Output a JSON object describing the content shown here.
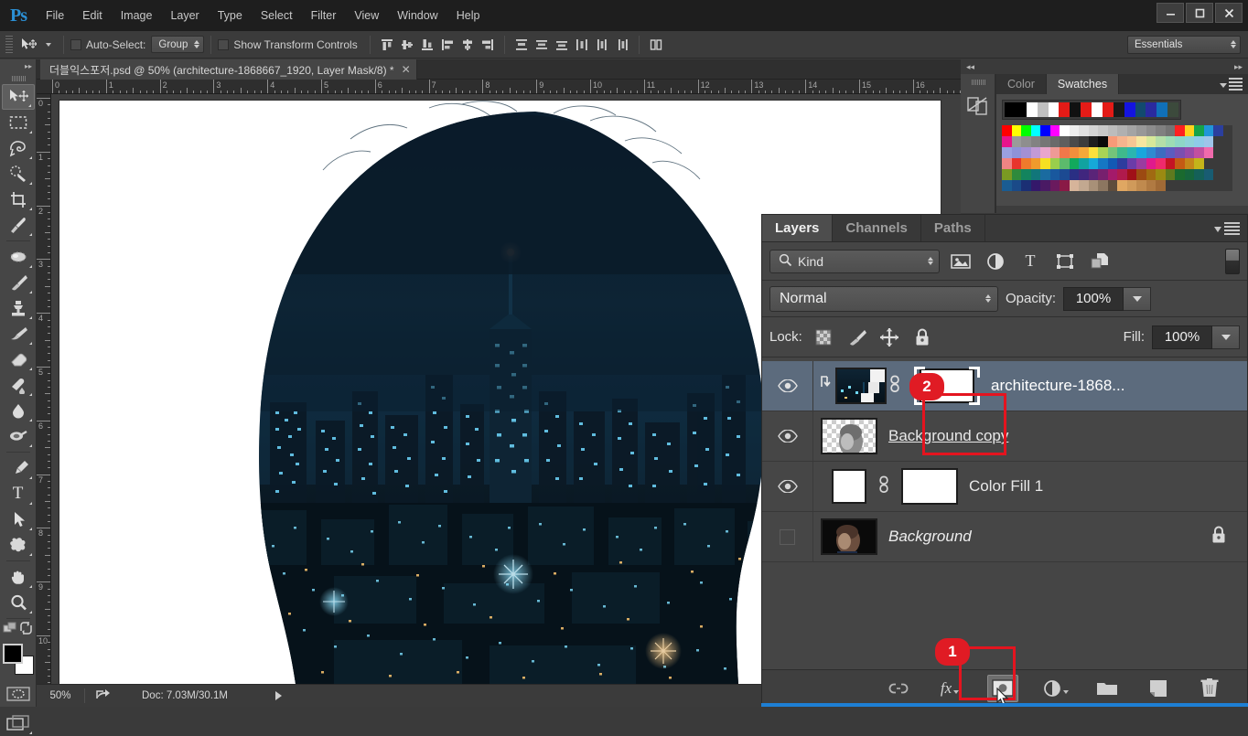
{
  "app": {
    "name": "Ps",
    "logo_color": "#2b8fd4"
  },
  "window_controls": {
    "minimize": "—",
    "maximize": "❐",
    "close": "✕"
  },
  "menubar": {
    "items": [
      "File",
      "Edit",
      "Image",
      "Layer",
      "Type",
      "Select",
      "Filter",
      "View",
      "Window",
      "Help"
    ]
  },
  "options_bar": {
    "tool_icon": "move-tool-icon",
    "auto_select_label": "Auto-Select:",
    "auto_select_checked": false,
    "auto_select_value": "Group",
    "show_transform_label": "Show Transform Controls",
    "show_transform_checked": false,
    "align_icons": [
      "align-top-edges",
      "align-vertical-centers",
      "align-bottom-edges",
      "align-left-edges",
      "align-horizontal-centers",
      "align-right-edges"
    ],
    "distribute_icons": [
      "distribute-top-edges",
      "distribute-vertical-centers",
      "distribute-bottom-edges",
      "distribute-left-edges",
      "distribute-horizontal-centers",
      "distribute-right-edges"
    ],
    "auto_align_icon": "auto-align-layers-icon",
    "workspace": "Essentials"
  },
  "toolbar": {
    "tools": [
      {
        "name": "move-tool",
        "glyph": "move",
        "active": true
      },
      {
        "name": "rectangular-marquee-tool",
        "glyph": "marquee"
      },
      {
        "name": "lasso-tool",
        "glyph": "lasso"
      },
      {
        "name": "quick-selection-tool",
        "glyph": "quickselect"
      },
      {
        "name": "crop-tool",
        "glyph": "crop"
      },
      {
        "name": "eyedropper-tool",
        "glyph": "eyedropper"
      },
      {
        "name": "spot-healing-brush-tool",
        "glyph": "heal"
      },
      {
        "name": "brush-tool",
        "glyph": "brush"
      },
      {
        "name": "clone-stamp-tool",
        "glyph": "stamp"
      },
      {
        "name": "history-brush-tool",
        "glyph": "historybrush"
      },
      {
        "name": "eraser-tool",
        "glyph": "eraser"
      },
      {
        "name": "gradient-tool",
        "glyph": "paintbucket"
      },
      {
        "name": "blur-tool",
        "glyph": "blur"
      },
      {
        "name": "dodge-tool",
        "glyph": "dodge"
      },
      {
        "name": "pen-tool",
        "glyph": "pen"
      },
      {
        "name": "horizontal-type-tool",
        "glyph": "type"
      },
      {
        "name": "path-selection-tool",
        "glyph": "pathselect"
      },
      {
        "name": "custom-shape-tool",
        "glyph": "shape"
      },
      {
        "name": "hand-tool",
        "glyph": "hand"
      },
      {
        "name": "zoom-tool",
        "glyph": "zoom"
      }
    ],
    "foreground_color": "#000000",
    "background_color": "#ffffff",
    "quick_mask_icon": "quick-mask-icon",
    "screen_mode_icon": "screen-mode-icon",
    "edit_toolbar_icon": "edit-toolbar-icon"
  },
  "document": {
    "tab_title": "더블익스포저.psd @ 50% (architecture-1868667_1920, Layer Mask/8) *",
    "close_glyph": "✕",
    "ruler_h_labels": [
      "0",
      "1",
      "2",
      "3",
      "4",
      "5",
      "6",
      "7",
      "8",
      "9",
      "10",
      "11",
      "12",
      "13",
      "14",
      "15",
      "16"
    ],
    "ruler_v_labels": [
      "0",
      "1",
      "2",
      "3",
      "4",
      "5",
      "6",
      "7",
      "8",
      "9",
      "10"
    ]
  },
  "status_bar": {
    "zoom": "50%",
    "share_icon": "share-icon",
    "doc_info": "Doc: 7.03M/30.1M",
    "arrow_icon": "play-arrow-icon"
  },
  "color_dock": {
    "collapse_left_icon": "collapse-left-icon",
    "expand_right_icon": "expand-right-icon",
    "icon_buttons": [
      "adjustments-icon"
    ],
    "tabs": [
      {
        "label": "Color",
        "active": false
      },
      {
        "label": "Swatches",
        "active": true
      }
    ],
    "menu_icon": "panel-menu-icon",
    "recent_swatches": [
      "#000000",
      "#000000",
      "#ffffff",
      "#c0c0c0",
      "#ffffff",
      "#e41b17",
      "#111111",
      "#e41b17",
      "#ffffff",
      "#e41b17",
      "#1a1a1a",
      "#1414e0",
      "#124a6e",
      "#2a2a9e",
      "#1070b8",
      "#3c4a3c"
    ],
    "swatch_rows": [
      [
        "#ff0000",
        "#ffff00",
        "#00ff00",
        "#00ffff",
        "#0000ff",
        "#ff00ff",
        "#ffffff",
        "#ededed",
        "#e0e0e0",
        "#d4d4d4",
        "#c8c8c8",
        "#bcbcbc",
        "#b0b0b0",
        "#a4a4a4",
        "#989898",
        "#8c8c8c",
        "#808080",
        "#747474",
        "#ff2020",
        "#ffd21e",
        "#16a349",
        "#2196d8",
        "#2b3f9e",
        "#3a3a3a"
      ],
      [
        "#e8148c",
        "#9a9a9a",
        "#8e8e8e",
        "#828282",
        "#767676",
        "#6a6a6a",
        "#5e5e5e",
        "#4a4a4a",
        "#3c3c3c",
        "#1e1e1e",
        "#0a0a0a",
        "#f79a78",
        "#f5b48e",
        "#f7c694",
        "#f5e6a0",
        "#d6e89a",
        "#b4dfa8",
        "#9ddcb4",
        "#8ed6c6",
        "#8fd2d8",
        "#8ecbe8",
        "#9ec5ea",
        "#3a3a3a",
        "#3a3a3a"
      ],
      [
        "#9aa0e0",
        "#8e92d8",
        "#a390d4",
        "#c29ad6",
        "#e9a6cc",
        "#ef9a96",
        "#f0784a",
        "#f28f3c",
        "#f5a83a",
        "#fbe03c",
        "#a8d455",
        "#74c47a",
        "#3fb98c",
        "#2bb5b0",
        "#19a6dc",
        "#2e8ad0",
        "#3c6cc0",
        "#5c5cc0",
        "#7a4fb0",
        "#9a4aa8",
        "#c24fa0",
        "#f06aac",
        "#3a3a3a",
        "#3a3a3a"
      ],
      [
        "#f08484",
        "#e8342c",
        "#ef7a2c",
        "#ef9a2c",
        "#f5e021",
        "#9ace4c",
        "#5cba6c",
        "#12a95c",
        "#11a2a0",
        "#16a8d8",
        "#1577c4",
        "#1259b4",
        "#2d3c9e",
        "#6b3ca8",
        "#9a3ca0",
        "#e01a8c",
        "#ef2a6c",
        "#c41424",
        "#c45a14",
        "#c4861a",
        "#c4b41a",
        "#3a3a3a",
        "#3a3a3a",
        "#3a3a3a"
      ],
      [
        "#7a9a22",
        "#2f8a3c",
        "#13845e",
        "#11767a",
        "#1a6ba0",
        "#19589e",
        "#1c4a92",
        "#2a2f84",
        "#40267e",
        "#5a2478",
        "#77206e",
        "#a41a6a",
        "#b01a4c",
        "#a01018",
        "#9c4a12",
        "#a06a12",
        "#9a8a12",
        "#5e7a1e",
        "#1a6a2e",
        "#16653c",
        "#146058",
        "#185c72",
        "#3a3a3a",
        "#3a3a3a"
      ],
      [
        "#1a5c92",
        "#1a4a88",
        "#1b2f74",
        "#34186a",
        "#4a1a64",
        "#6a1a5e",
        "#8a1a46",
        "#d6b49a",
        "#c2a890",
        "#a89078",
        "#8c7660",
        "#5e4c3c",
        "#e0a762",
        "#d09a5a",
        "#c08a4e",
        "#b07a42",
        "#a06a36",
        "#3a3a3a",
        "#3a3a3a",
        "#3a3a3a",
        "#3a3a3a",
        "#3a3a3a",
        "#3a3a3a",
        "#3a3a3a"
      ]
    ]
  },
  "layers_panel": {
    "tabs": [
      {
        "label": "Layers",
        "active": true
      },
      {
        "label": "Channels",
        "active": false
      },
      {
        "label": "Paths",
        "active": false
      }
    ],
    "menu_icon": "panel-menu-icon",
    "filter": {
      "kind_label": "Kind",
      "search_icon": "search-icon",
      "type_filters": [
        "filter-pixel-layers-icon",
        "filter-adjustment-layers-icon",
        "filter-type-layers-icon",
        "filter-shape-layers-icon",
        "filter-smart-objects-icon"
      ],
      "toggle_icon": "filter-toggle-icon"
    },
    "blend_mode": "Normal",
    "opacity_label": "Opacity:",
    "opacity_value": "100%",
    "lock_label": "Lock:",
    "lock_icons": [
      "lock-transparent-pixels-icon",
      "lock-image-pixels-icon",
      "lock-position-icon",
      "lock-all-icon"
    ],
    "fill_label": "Fill:",
    "fill_value": "100%",
    "rows": [
      {
        "name": "architecture-1868...",
        "visible": true,
        "selected": true,
        "clipped": true,
        "thumb": "city-thumbnail",
        "linked": true,
        "mask": "white-mask-selected",
        "locked": false,
        "style": "normal"
      },
      {
        "name": "Background copy",
        "visible": true,
        "selected": false,
        "clipped": false,
        "thumb": "head-transparent-thumbnail",
        "linked": false,
        "mask": null,
        "locked": false,
        "style": "underline"
      },
      {
        "name": "Color Fill 1",
        "visible": true,
        "selected": false,
        "clipped": false,
        "thumb": "white-fill-thumbnail",
        "linked": true,
        "mask": "white-mask",
        "locked": false,
        "style": "normal"
      },
      {
        "name": "Background",
        "visible": false,
        "selected": false,
        "clipped": false,
        "thumb": "portrait-thumbnail",
        "linked": false,
        "mask": null,
        "locked": true,
        "style": "italic"
      }
    ],
    "bottom_buttons": [
      {
        "name": "link-layers-button",
        "icon": "link-icon"
      },
      {
        "name": "layer-style-button",
        "icon": "fx-icon"
      },
      {
        "name": "add-layer-mask-button",
        "icon": "add-layer-mask-icon",
        "highlighted": true
      },
      {
        "name": "new-adjustment-layer-button",
        "icon": "adjustment-circle-icon"
      },
      {
        "name": "new-group-button",
        "icon": "folder-icon"
      },
      {
        "name": "new-layer-button",
        "icon": "new-layer-icon"
      },
      {
        "name": "delete-layer-button",
        "icon": "trash-icon"
      }
    ]
  },
  "callouts": [
    {
      "number": "1",
      "target": "add-layer-mask-button"
    },
    {
      "number": "2",
      "target": "layer-mask-thumbnail"
    }
  ],
  "accent_colors": {
    "callout_red": "#e01b24",
    "highlight_box_red": "#e4141f",
    "selection_blue": "#5c6b7d",
    "taskbar_blue": "#1e7fd4"
  }
}
